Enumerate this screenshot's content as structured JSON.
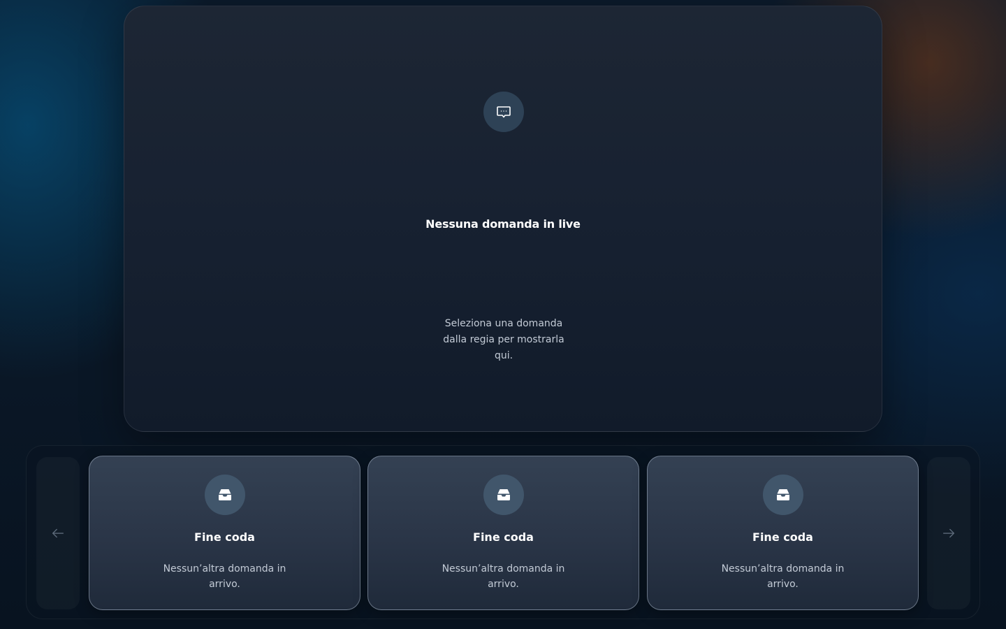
{
  "stage": {
    "icon": "chat-bubble-icon",
    "title": "Nessuna domanda in live",
    "subtitle": "Seleziona una domanda dalla regia per mostrarla qui."
  },
  "queue": {
    "prev_icon": "arrow-left-icon",
    "next_icon": "arrow-right-icon",
    "cards": [
      {
        "icon": "inbox-icon",
        "title": "Fine coda",
        "subtitle": "Nessun’altra domanda in arrivo."
      },
      {
        "icon": "inbox-icon",
        "title": "Fine coda",
        "subtitle": "Nessun’altra domanda in arrivo."
      },
      {
        "icon": "inbox-icon",
        "title": "Fine coda",
        "subtitle": "Nessun’altra domanda in arrivo."
      }
    ]
  }
}
